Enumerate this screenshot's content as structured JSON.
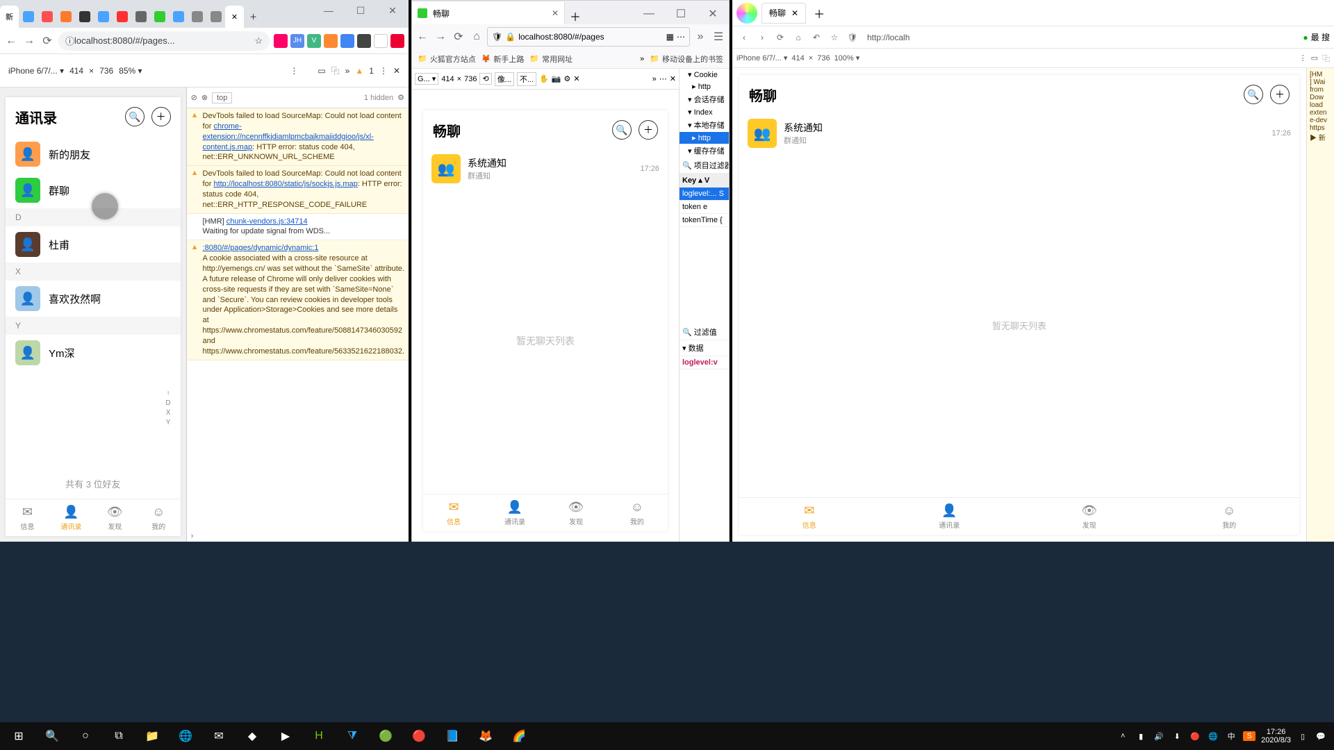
{
  "win1": {
    "url_label": "localhost:8080/#/pages...",
    "device": "iPhone 6/7/... ▾",
    "dim_w": "414",
    "dim_x": "×",
    "dim_h": "736",
    "zoom": "85% ▾",
    "console_ctx": "top",
    "hidden": "1 hidden",
    "err_badge": "1",
    "msgs": [
      {
        "type": "warn",
        "text": "DevTools failed to load SourceMap: Could not load content for ",
        "link": "chrome-extension://ncennffkjdiamlpmcbajkmaiiddgioo/js/xl-content.js.map",
        "tail": ": HTTP error: status code 404, net::ERR_UNKNOWN_URL_SCHEME"
      },
      {
        "type": "warn",
        "text": "DevTools failed to load SourceMap: Could not load content for ",
        "link": "http://localhost:8080/static/js/sockjs.js.map",
        "tail": ": HTTP error: status code 404, net::ERR_HTTP_RESPONSE_CODE_FAILURE"
      },
      {
        "type": "plain",
        "text": "[HMR] ",
        "link": "chunk-vendors.js:34714",
        "tail": "\nWaiting for update signal from WDS..."
      },
      {
        "type": "warn",
        "text": "",
        "link": ":8080/#/pages/dynamic/dynamic:1",
        "tail": "\nA cookie associated with a cross-site resource at http://yemengs.cn/ was set without the `SameSite` attribute. A future release of Chrome will only deliver cookies with cross-site requests if they are set with `SameSite=None` and `Secure`. You can review cookies in developer tools under Application>Storage>Cookies and see more details at https://www.chromestatus.com/feature/5088147346030592 and https://www.chromestatus.com/feature/5633521622188032."
      }
    ],
    "app": {
      "title": "通讯录",
      "rows": [
        {
          "type": "item",
          "label": "新的朋友",
          "bg": "#ff9d4d"
        },
        {
          "type": "item",
          "label": "群聊",
          "bg": "#2ecc40"
        },
        {
          "type": "section",
          "label": "D"
        },
        {
          "type": "item",
          "label": "杜甫",
          "bg": "#5a3c2e"
        },
        {
          "type": "section",
          "label": "X"
        },
        {
          "type": "item",
          "label": "喜欢孜然啊",
          "bg": "#a0c8e8"
        },
        {
          "type": "section",
          "label": "Y"
        },
        {
          "type": "item",
          "label": "Ym深",
          "bg": "#bcd8a8"
        }
      ],
      "index_letters": [
        "↑",
        "D",
        "X",
        "Y"
      ],
      "footer_count": "共有 3 位好友",
      "tabs": [
        {
          "label": "信息",
          "icon": "✉"
        },
        {
          "label": "通讯录",
          "icon": "👤",
          "on": true
        },
        {
          "label": "发现",
          "icon": "👁"
        },
        {
          "label": "我的",
          "icon": "☺"
        }
      ]
    }
  },
  "win2": {
    "tab_title": "畅聊",
    "url": "localhost:8080/#/pages",
    "bookmarks": [
      "火狐官方站点",
      "新手上路",
      "常用网址"
    ],
    "right_bm": "移动设备上的书签",
    "dev_w": "414",
    "dev_h": "736",
    "dev_style": "像...",
    "dev_none": "不...",
    "storage_tree": [
      "Cookie",
      "  http",
      "会话存储",
      "Index",
      "本地存储",
      "  http",
      "缓存存储"
    ],
    "filter_label": "项目过滤器",
    "kv_headers": [
      "Key",
      "V"
    ],
    "kv_rows": [
      [
        "loglevel:...",
        "S"
      ],
      [
        "token",
        "e"
      ],
      [
        "tokenTime",
        "{"
      ]
    ],
    "filter2": "过滤值",
    "data_hdr": "数据",
    "data_val": "loglevel:v",
    "app": {
      "title": "畅聊",
      "chat": {
        "name": "系统通知",
        "sub": "群通知",
        "time": "17:26"
      },
      "empty": "暂无聊天列表",
      "tabs": [
        {
          "label": "信息",
          "icon": "✉",
          "on": true
        },
        {
          "label": "通讯录",
          "icon": "👤"
        },
        {
          "label": "发现",
          "icon": "👁"
        },
        {
          "label": "我的",
          "icon": "☺"
        }
      ]
    }
  },
  "win3": {
    "tab_title": "畅聊",
    "url": "http://localh",
    "search_hint": "最 搜",
    "device": "iPhone 6/7/... ▾",
    "dim_w": "414",
    "dim_x": "×",
    "dim_h": "736",
    "zoom": "100% ▾",
    "app": {
      "title": "畅聊",
      "chat": {
        "name": "系统通知",
        "sub": "群通知",
        "time": "17:26"
      },
      "empty": "暂无聊天列表",
      "tabs": [
        {
          "label": "信息",
          "icon": "✉",
          "on": true
        },
        {
          "label": "通讯录",
          "icon": "👤"
        },
        {
          "label": "发现",
          "icon": "👁"
        },
        {
          "label": "我的",
          "icon": "☺"
        }
      ]
    },
    "console_snips": [
      "[HM",
      "] Wai",
      "from",
      "Dow",
      "load",
      "exten",
      "e-dev",
      "https",
      "▶ 新"
    ]
  },
  "taskbar": {
    "time": "17:26",
    "date": "2020/8/3",
    "ime": "中",
    "tray": [
      "^",
      "▮",
      "🔊",
      "🔋",
      "🔵",
      "🌐",
      "中",
      "S"
    ]
  }
}
